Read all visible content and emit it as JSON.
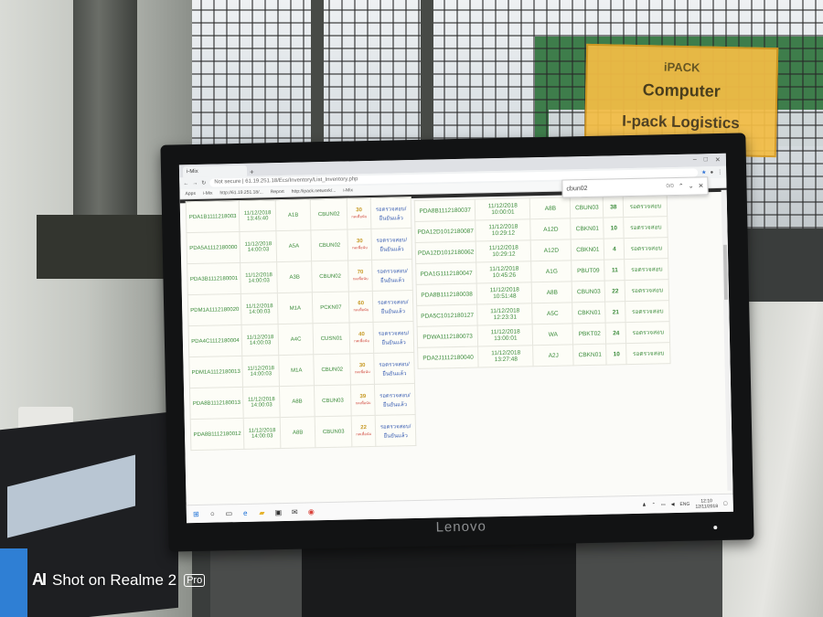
{
  "sign": {
    "line1": "iPACK",
    "line2": "Computer",
    "line3": "I-pack  Logistics"
  },
  "browser": {
    "tab_label": "i-Mix",
    "new_tab": "+",
    "window_controls": [
      "–",
      "□",
      "✕"
    ],
    "url": "Not secure | 61.19.251.18/Ecs/Inventory/List_Inventory.php",
    "bookmarks": [
      "Apps",
      "i-Mix",
      "http://61.19.251.18/...",
      "Report",
      "http://ipack.network/...",
      "i-Mix"
    ],
    "find": {
      "query": "cbun02",
      "count": "0/0"
    }
  },
  "left_table": {
    "rows": [
      {
        "id": "PDA1B1111218003",
        "dt": "11/12/2018 13:45:40",
        "loc": "A1B",
        "cb": "CBUN02",
        "qty": "30",
        "qty_note": "กดเพื่อนับ",
        "status": "รอตรวจสอบ/ยืนยันแล้ว"
      },
      {
        "id": "PDA5A1112180000",
        "dt": "11/12/2018 14:00:03",
        "loc": "A5A",
        "cb": "CBUN02",
        "qty": "30",
        "qty_note": "กดเพื่อนับ",
        "status": "รอตรวจสอบ/ยืนยันแล้ว"
      },
      {
        "id": "PDA3B1112180001",
        "dt": "11/12/2018 14:00:03",
        "loc": "A3B",
        "cb": "CBUN02",
        "qty": "70",
        "qty_note": "กดเพื่อนับ",
        "status": "รอตรวจสอบ/ยืนยันแล้ว"
      },
      {
        "id": "PDM1A1112180020",
        "dt": "11/12/2018 14:00:03",
        "loc": "M1A",
        "cb": "PCKN07",
        "qty": "60",
        "qty_note": "กดเพื่อนับ",
        "status": "รอตรวจสอบ/ยืนยันแล้ว"
      },
      {
        "id": "PDA4C1112180004",
        "dt": "11/12/2018 14:00:03",
        "loc": "A4C",
        "cb": "CUSN01",
        "qty": "40",
        "qty_note": "กดเพื่อนับ",
        "status": "รอตรวจสอบ/ยืนยันแล้ว"
      },
      {
        "id": "PDM1A1112180013",
        "dt": "11/12/2018 14:00:03",
        "loc": "M1A",
        "cb": "CBUN02",
        "qty": "30",
        "qty_note": "กดเพื่อนับ",
        "status": "รอตรวจสอบ/ยืนยันแล้ว"
      },
      {
        "id": "PDA8B1112180013",
        "dt": "11/12/2018 14:00:03",
        "loc": "A8B",
        "cb": "CBUN03",
        "qty": "39",
        "qty_note": "กดเพื่อนับ",
        "status": "รอตรวจสอบ/ยืนยันแล้ว"
      },
      {
        "id": "PDA8B1112180012",
        "dt": "11/12/2018 14:00:03",
        "loc": "A8B",
        "cb": "CBUN03",
        "qty": "22",
        "qty_note": "กดเพื่อนับ",
        "status": "รอตรวจสอบ/ยืนยันแล้ว"
      }
    ]
  },
  "right_table": {
    "rows": [
      {
        "id": "PDA8B1112180037",
        "dt": "11/12/2018 10:00:01",
        "loc": "A8B",
        "cb": "CBUN03",
        "qty": "38",
        "status": "รอตรวจสอบ"
      },
      {
        "id": "PDA12D1012180087",
        "dt": "11/12/2018 10:29:12",
        "loc": "A12D",
        "cb": "CBKN01",
        "qty": "10",
        "status": "รอตรวจสอบ"
      },
      {
        "id": "PDA12D1012180062",
        "dt": "11/12/2018 10:29:12",
        "loc": "A12D",
        "cb": "CBKN01",
        "qty": "4",
        "status": "รอตรวจสอบ"
      },
      {
        "id": "PDA1G1112180047",
        "dt": "11/12/2018 10:45:26",
        "loc": "A1G",
        "cb": "PBUT09",
        "qty": "11",
        "status": "รอตรวจสอบ"
      },
      {
        "id": "PDA8B1112180038",
        "dt": "11/12/2018 10:51:48",
        "loc": "A8B",
        "cb": "CBUN03",
        "qty": "22",
        "status": "รอตรวจสอบ"
      },
      {
        "id": "PDA5C1012180127",
        "dt": "11/12/2018 12:23:31",
        "loc": "A5C",
        "cb": "CBKN01",
        "qty": "21",
        "status": "รอตรวจสอบ"
      },
      {
        "id": "PDWA1112180073",
        "dt": "11/12/2018 13:00:01",
        "loc": "WA",
        "cb": "PBKT02",
        "qty": "24",
        "status": "รอตรวจสอบ"
      },
      {
        "id": "PDA2J1112180040",
        "dt": "11/12/2018 13:27:48",
        "loc": "A2J",
        "cb": "CBKN01",
        "qty": "10",
        "status": "รอตรวจสอบ"
      }
    ]
  },
  "taskbar": {
    "time": "12:10",
    "date": "12/11/2018",
    "lang": "ENG"
  },
  "monitor_brand": "Lenovo",
  "watermark": {
    "logo": "AI",
    "text": "Shot on Realme 2",
    "badge": "Pro"
  },
  "colors": {
    "text_green": "#3c8c3c",
    "status_blue": "#3b5fb3",
    "sign_yellow": "#f3bd45"
  }
}
